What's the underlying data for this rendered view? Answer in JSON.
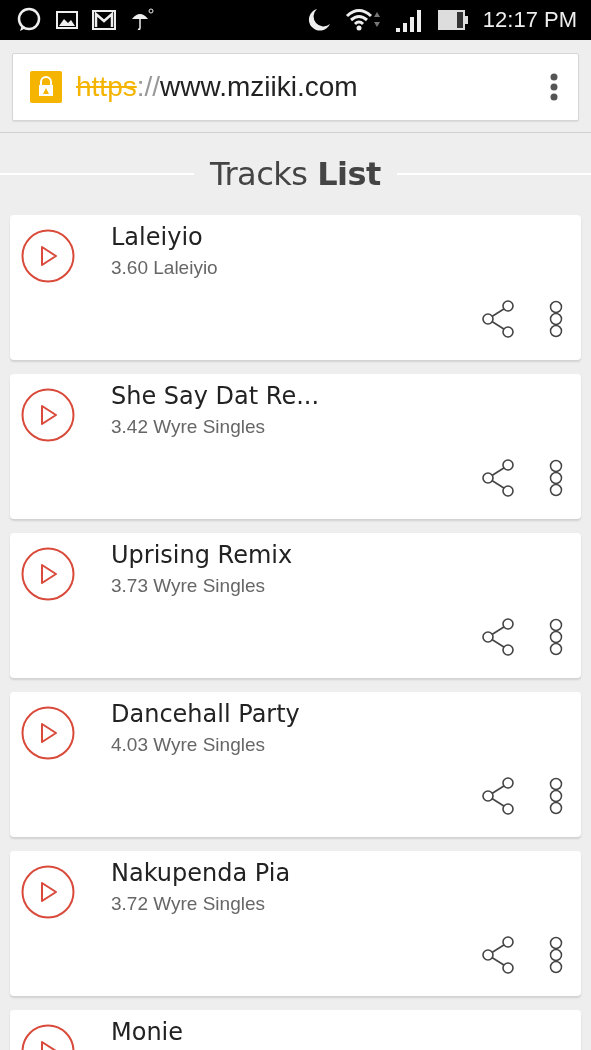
{
  "status_bar": {
    "time": "12:17 PM"
  },
  "address_bar": {
    "scheme": "https",
    "separator": "://",
    "host": "www.mziiki.com",
    "secure": true
  },
  "heading": "Tracks **List**",
  "tracks": [
    {
      "title": "Laleiyio",
      "subtitle": "3.60 Laleiyio"
    },
    {
      "title": "She Say Dat Re...",
      "subtitle": "3.42 Wyre Singles"
    },
    {
      "title": "Uprising Remix",
      "subtitle": "3.73 Wyre Singles"
    },
    {
      "title": "Dancehall Party",
      "subtitle": "4.03 Wyre Singles"
    },
    {
      "title": "Nakupenda Pia",
      "subtitle": "3.72 Wyre Singles"
    },
    {
      "title": "Monie"
    }
  ]
}
